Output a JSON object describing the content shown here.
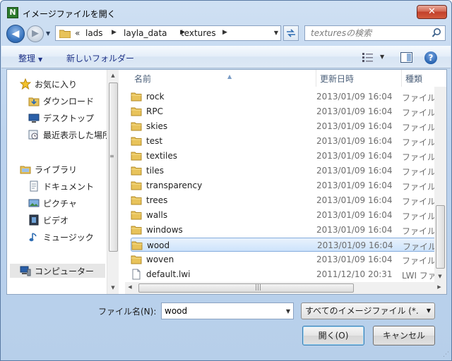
{
  "window": {
    "title": "イメージファイルを開く",
    "app_icon_letter": "N",
    "close_glyph": "✕"
  },
  "nav": {
    "back_glyph": "◀",
    "forward_glyph": "▶",
    "address": {
      "overflow": "«",
      "crumbs": [
        "lads",
        "layla_data",
        "textures"
      ]
    },
    "search_placeholder": "texturesの検索"
  },
  "toolbar": {
    "organize_label": "整理",
    "new_folder_label": "新しいフォルダー",
    "help_glyph": "?"
  },
  "sidebar": {
    "items": [
      {
        "label": "お気に入り",
        "icon": "star-icon",
        "kind": "group"
      },
      {
        "label": "ダウンロード",
        "icon": "download-folder-icon"
      },
      {
        "label": "デスクトップ",
        "icon": "desktop-icon"
      },
      {
        "label": "最近表示した場所",
        "icon": "recent-places-icon"
      },
      {
        "label": "ライブラリ",
        "icon": "library-icon",
        "kind": "group"
      },
      {
        "label": "ドキュメント",
        "icon": "documents-icon"
      },
      {
        "label": "ピクチャ",
        "icon": "pictures-icon"
      },
      {
        "label": "ビデオ",
        "icon": "videos-icon"
      },
      {
        "label": "ミュージック",
        "icon": "music-icon"
      },
      {
        "label": "コンピューター",
        "icon": "computer-icon",
        "kind": "group"
      }
    ]
  },
  "columns": {
    "name": "名前",
    "date": "更新日時",
    "type": "種類"
  },
  "files": [
    {
      "name": "rock",
      "date": "2013/01/09 16:04",
      "type": "ファイル",
      "kind": "folder"
    },
    {
      "name": "RPC",
      "date": "2013/01/09 16:04",
      "type": "ファイル",
      "kind": "folder"
    },
    {
      "name": "skies",
      "date": "2013/01/09 16:04",
      "type": "ファイル",
      "kind": "folder"
    },
    {
      "name": "test",
      "date": "2013/01/09 16:04",
      "type": "ファイル",
      "kind": "folder"
    },
    {
      "name": "textiles",
      "date": "2013/01/09 16:04",
      "type": "ファイル",
      "kind": "folder"
    },
    {
      "name": "tiles",
      "date": "2013/01/09 16:04",
      "type": "ファイル",
      "kind": "folder"
    },
    {
      "name": "transparency",
      "date": "2013/01/09 16:04",
      "type": "ファイル",
      "kind": "folder"
    },
    {
      "name": "trees",
      "date": "2013/01/09 16:04",
      "type": "ファイル",
      "kind": "folder"
    },
    {
      "name": "walls",
      "date": "2013/01/09 16:04",
      "type": "ファイル",
      "kind": "folder"
    },
    {
      "name": "windows",
      "date": "2013/01/09 16:04",
      "type": "ファイル",
      "kind": "folder"
    },
    {
      "name": "wood",
      "date": "2013/01/09 16:04",
      "type": "ファイル",
      "kind": "folder",
      "selected": true
    },
    {
      "name": "woven",
      "date": "2013/01/09 16:04",
      "type": "ファイル",
      "kind": "folder"
    },
    {
      "name": "default.lwi",
      "date": "2011/12/10 20:31",
      "type": "LWI ファ",
      "kind": "file"
    }
  ],
  "bottom": {
    "filename_label": "ファイル名(N):",
    "filename_value": "wood",
    "filter_value": "すべてのイメージファイル (*.",
    "open_label": "開く(O)",
    "cancel_label": "キャンセル"
  },
  "colors": {
    "selection": "#cde3fb",
    "folder": "#e8c35a",
    "link": "#1e3287"
  }
}
